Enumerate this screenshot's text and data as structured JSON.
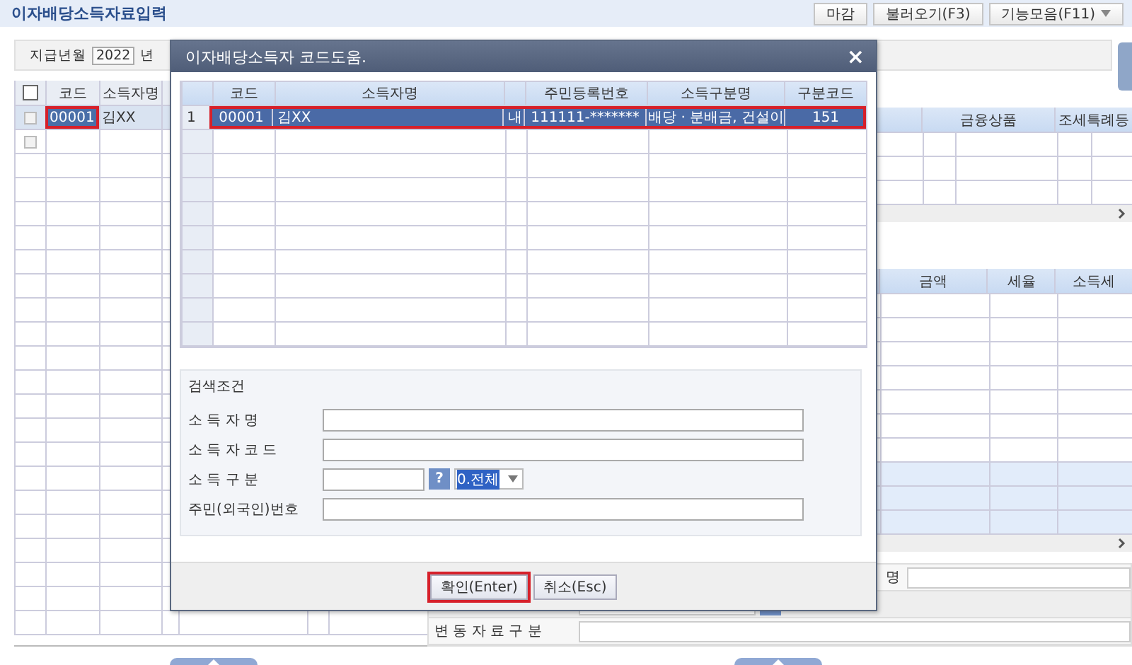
{
  "page_title": "이자배당소득자료입력",
  "toolbar_buttons": [
    {
      "label": "마감",
      "kind": "plain"
    },
    {
      "label": "불러오기(F3)",
      "kind": "plain"
    },
    {
      "label": "기능모음(F11)",
      "kind": "dropdown"
    }
  ],
  "filter": {
    "label": "지급년월",
    "year": "2022",
    "unit": "년"
  },
  "income_table": {
    "select_all_checked": false,
    "columns": [
      "코드",
      "소득자명"
    ],
    "rows": [
      {
        "checked": false,
        "code": "00001",
        "name": "김XX",
        "selected": true,
        "highlighted": true
      },
      {
        "checked": false,
        "selected": false,
        "highlighted": false
      }
    ]
  },
  "product_table": {
    "columns": [
      "금융상품",
      "조세특례등"
    ]
  },
  "tax_table": {
    "columns": [
      "금액",
      "세율",
      "소득세"
    ]
  },
  "detail_form": {
    "name_label": "명",
    "change_label": "변 동 자 료 구 분"
  },
  "dialog": {
    "title": "이자배당소득자 코드도움.",
    "close": "×",
    "columns": [
      "코드",
      "소득자명",
      "주민등록번호",
      "소득구분명",
      "구분코드"
    ],
    "rows": [
      {
        "number": "1",
        "code": "00001",
        "name": "김XX",
        "nationality": "내",
        "resident_no": "111111-*******",
        "income_type": "배당 · 분배금, 건설이",
        "type_code": "151",
        "selected": true,
        "highlighted": true
      }
    ],
    "search": {
      "title": "검색조건",
      "fields": [
        {
          "label": "소 득 자 명",
          "kind": "text"
        },
        {
          "label": "소 득 자 코 드",
          "kind": "text"
        },
        {
          "label": "소 득 구 분",
          "kind": "lookup",
          "help": "?",
          "option": "0.전체"
        },
        {
          "label": "주민(외국인)번호",
          "kind": "text"
        }
      ]
    },
    "buttons": [
      {
        "label": "확인(Enter)",
        "highlighted": true
      },
      {
        "label": "취소(Esc)",
        "highlighted": false
      }
    ]
  }
}
